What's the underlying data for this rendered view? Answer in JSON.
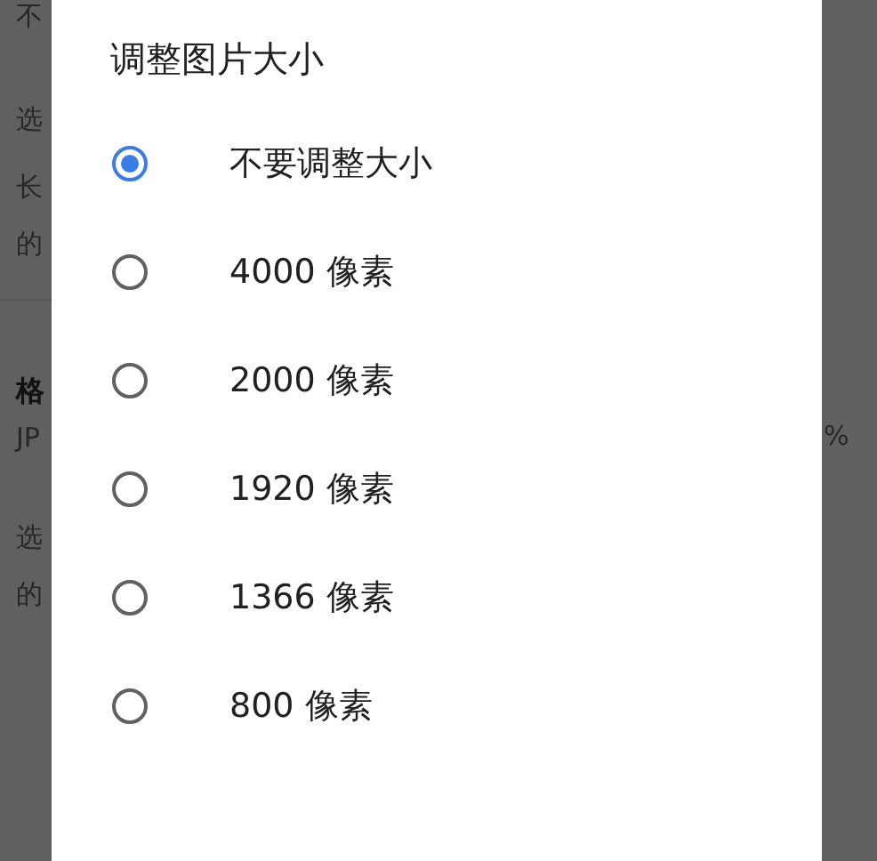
{
  "background": {
    "left_fragments": [
      {
        "text": "不",
        "kind": "text"
      },
      {
        "text": "选",
        "kind": "text"
      },
      {
        "text": "长",
        "kind": "text"
      },
      {
        "text": "的",
        "kind": "text"
      },
      {
        "text": "格",
        "kind": "heading"
      },
      {
        "text": "JP",
        "kind": "text"
      },
      {
        "text": "选",
        "kind": "text"
      },
      {
        "text": "的",
        "kind": "text"
      }
    ],
    "right_fragments": [
      "%"
    ]
  },
  "dialog": {
    "title": "调整图片大小",
    "options": [
      {
        "label": "不要调整大小",
        "selected": true
      },
      {
        "label": "4000 像素",
        "selected": false
      },
      {
        "label": "2000 像素",
        "selected": false
      },
      {
        "label": "1920 像素",
        "selected": false
      },
      {
        "label": "1366 像素",
        "selected": false
      },
      {
        "label": "800 像素",
        "selected": false
      }
    ]
  }
}
